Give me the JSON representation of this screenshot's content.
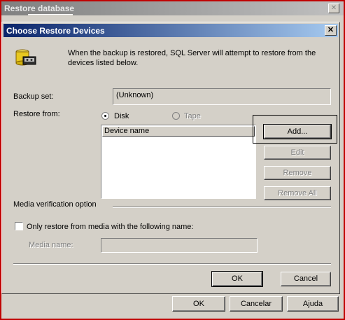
{
  "parent_window": {
    "title": "Restore database",
    "buttons": {
      "ok": "OK",
      "cancel": "Cancelar",
      "help": "Ajuda"
    }
  },
  "dialog": {
    "title": "Choose Restore Devices",
    "intro_text": "When the backup is restored, SQL Server will attempt to restore from the devices listed below.",
    "backup_set_label": "Backup set:",
    "backup_set_value": "(Unknown)",
    "restore_from_label": "Restore from:",
    "restore_from_options": {
      "disk": "Disk",
      "tape": "Tape"
    },
    "restore_from_selected": "Disk",
    "device_list_header": "Device name",
    "device_buttons": {
      "add": "Add...",
      "edit": "Edit",
      "remove": "Remove",
      "remove_all": "Remove All"
    },
    "media_verification_label": "Media verification option",
    "only_restore_checkbox_label": "Only restore from media with the following name:",
    "media_name_label": "Media name:",
    "media_name_value": "",
    "buttons": {
      "ok": "OK",
      "cancel": "Cancel"
    }
  }
}
